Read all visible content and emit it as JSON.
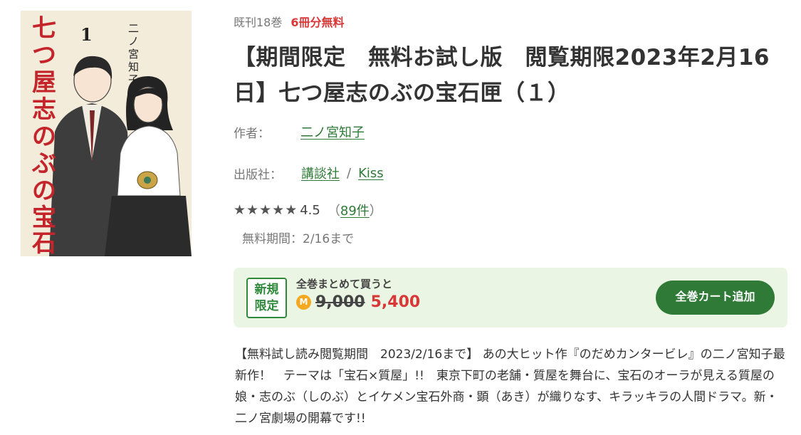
{
  "cover": {
    "title": "七つ屋志のぶの宝石匣",
    "volume": "1",
    "author": "二ノ宮知子"
  },
  "meta": {
    "volumes": "既刊18巻",
    "free_badge": "6冊分無料"
  },
  "title": "【期間限定　無料お試し版　閲覧期限2023年2月16日】七つ屋志のぶの宝石匣（１）",
  "author": {
    "label": "作者：",
    "name": "二ノ宮知子"
  },
  "publisher": {
    "label": "出版社：",
    "name": "講談社",
    "separator": "/",
    "label_name": "Kiss"
  },
  "rating": {
    "stars": 4.5,
    "value": "4.5",
    "paren_open": "（",
    "count": "89件",
    "paren_close": "）"
  },
  "free_period": "無料期間：2/16まで",
  "bundle": {
    "badge_line1": "新規",
    "badge_line2": "限定",
    "caption": "全巻まとめて買うと",
    "coin": "M",
    "old_price": "9,000",
    "new_price": "5,400",
    "cart_button": "全巻カート追加"
  },
  "description": "【無料試し読み閲覧期間　2023/2/16まで】 あの大ヒット作『のだめカンタービレ』の二ノ宮知子最新作！　テーマは「宝石×質屋」!!　東京下町の老舗・質屋を舞台に、宝石のオーラが見える質屋の娘・志のぶ（しのぶ）とイケメン宝石外商・顕（あき）が織りなす、キラッキラの人間ドラマ。新・二ノ宮劇場の開幕です!!",
  "colors": {
    "accent_green": "#2e7a36",
    "price_red": "#d93838",
    "bundle_bg": "#eaf5e3",
    "coin": "#f3a81f"
  }
}
